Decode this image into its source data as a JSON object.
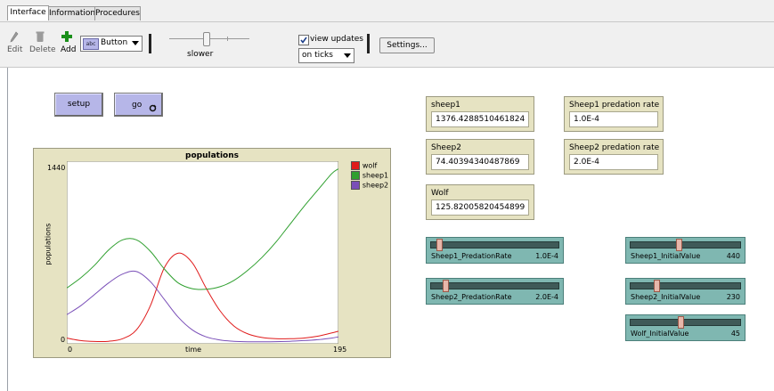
{
  "tabs": [
    {
      "label": "Interface"
    },
    {
      "label": "Information"
    },
    {
      "label": "Procedures"
    }
  ],
  "toolbar": {
    "edit_label": "Edit",
    "delete_label": "Delete",
    "add_label": "Add",
    "widget_select_value": "Button",
    "speed_label": "slower",
    "view_updates_label": "view updates",
    "view_updates_checked": true,
    "update_mode_value": "on ticks",
    "settings_label": "Settings..."
  },
  "buttons": {
    "setup_label": "setup",
    "go_label": "go"
  },
  "plot": {
    "title": "populations",
    "xlabel": "time",
    "ylabel": "populations",
    "xmin_label": "0",
    "xmax_label": "195",
    "ymin_label": "0",
    "ymax_label": "1440",
    "legend": [
      {
        "name": "wolf",
        "color": "#e01b1b"
      },
      {
        "name": "sheep1",
        "color": "#2e9f2e"
      },
      {
        "name": "sheep2",
        "color": "#7a4fb8"
      }
    ]
  },
  "chart_data": {
    "type": "line",
    "title": "populations",
    "xlabel": "time",
    "ylabel": "populations",
    "xlim": [
      0,
      195
    ],
    "ylim": [
      0,
      1440
    ],
    "legend_placement": "top-right",
    "series": [
      {
        "name": "wolf",
        "color": "#e01b1b",
        "x": [
          0,
          10,
          20,
          30,
          40,
          50,
          60,
          70,
          80,
          90,
          100,
          110,
          120,
          130,
          140,
          150,
          160,
          170,
          180,
          190,
          195
        ],
        "y": [
          45,
          25,
          18,
          20,
          40,
          110,
          300,
          600,
          715,
          640,
          440,
          260,
          140,
          78,
          50,
          40,
          40,
          45,
          60,
          85,
          100
        ]
      },
      {
        "name": "sheep1",
        "color": "#2e9f2e",
        "x": [
          0,
          10,
          20,
          30,
          40,
          50,
          60,
          70,
          80,
          90,
          100,
          110,
          120,
          130,
          140,
          150,
          160,
          170,
          180,
          190,
          195
        ],
        "y": [
          440,
          520,
          620,
          740,
          820,
          820,
          730,
          590,
          480,
          435,
          430,
          450,
          500,
          580,
          680,
          800,
          940,
          1080,
          1210,
          1340,
          1380
        ]
      },
      {
        "name": "sheep2",
        "color": "#7a4fb8",
        "x": [
          0,
          10,
          20,
          30,
          40,
          50,
          60,
          70,
          80,
          90,
          100,
          110,
          120,
          130,
          140,
          150,
          160,
          170,
          180,
          190,
          195
        ],
        "y": [
          230,
          300,
          390,
          480,
          550,
          570,
          490,
          350,
          210,
          110,
          55,
          30,
          20,
          16,
          16,
          17,
          20,
          25,
          32,
          45,
          55
        ]
      }
    ]
  },
  "monitors": [
    {
      "label": "sheep1",
      "value": "1376.4288510461824"
    },
    {
      "label": "Sheep2",
      "value": "74.40394340487869"
    },
    {
      "label": "Wolf",
      "value": "125.82005820454899"
    },
    {
      "label": "Sheep1 predation rate",
      "value": "1.0E-4"
    },
    {
      "label": "Sheep2 predation rate",
      "value": "2.0E-4"
    }
  ],
  "sliders": [
    {
      "name": "Sheep1_PredationRate",
      "value": "1.0E-4",
      "fraction": 0.05
    },
    {
      "name": "Sheep2_PredationRate",
      "value": "2.0E-4",
      "fraction": 0.1
    },
    {
      "name": "Sheep1_InitialValue",
      "value": "440",
      "fraction": 0.44
    },
    {
      "name": "Sheep2_InitialValue",
      "value": "230",
      "fraction": 0.23
    },
    {
      "name": "Wolf_InitialValue",
      "value": "45",
      "fraction": 0.45
    }
  ]
}
